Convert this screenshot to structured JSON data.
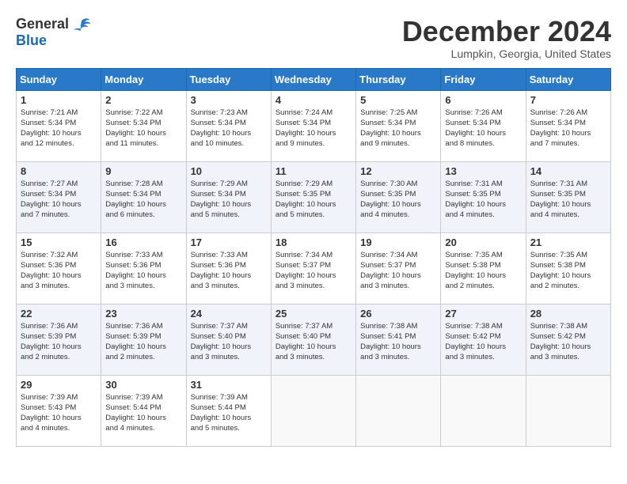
{
  "logo": {
    "general": "General",
    "blue": "Blue"
  },
  "title": "December 2024",
  "location": "Lumpkin, Georgia, United States",
  "days_of_week": [
    "Sunday",
    "Monday",
    "Tuesday",
    "Wednesday",
    "Thursday",
    "Friday",
    "Saturday"
  ],
  "weeks": [
    [
      {
        "day": "1",
        "sunrise": "7:21 AM",
        "sunset": "5:34 PM",
        "daylight": "10 hours and 12 minutes."
      },
      {
        "day": "2",
        "sunrise": "7:22 AM",
        "sunset": "5:34 PM",
        "daylight": "10 hours and 11 minutes."
      },
      {
        "day": "3",
        "sunrise": "7:23 AM",
        "sunset": "5:34 PM",
        "daylight": "10 hours and 10 minutes."
      },
      {
        "day": "4",
        "sunrise": "7:24 AM",
        "sunset": "5:34 PM",
        "daylight": "10 hours and 9 minutes."
      },
      {
        "day": "5",
        "sunrise": "7:25 AM",
        "sunset": "5:34 PM",
        "daylight": "10 hours and 9 minutes."
      },
      {
        "day": "6",
        "sunrise": "7:26 AM",
        "sunset": "5:34 PM",
        "daylight": "10 hours and 8 minutes."
      },
      {
        "day": "7",
        "sunrise": "7:26 AM",
        "sunset": "5:34 PM",
        "daylight": "10 hours and 7 minutes."
      }
    ],
    [
      {
        "day": "8",
        "sunrise": "7:27 AM",
        "sunset": "5:34 PM",
        "daylight": "10 hours and 7 minutes."
      },
      {
        "day": "9",
        "sunrise": "7:28 AM",
        "sunset": "5:34 PM",
        "daylight": "10 hours and 6 minutes."
      },
      {
        "day": "10",
        "sunrise": "7:29 AM",
        "sunset": "5:34 PM",
        "daylight": "10 hours and 5 minutes."
      },
      {
        "day": "11",
        "sunrise": "7:29 AM",
        "sunset": "5:35 PM",
        "daylight": "10 hours and 5 minutes."
      },
      {
        "day": "12",
        "sunrise": "7:30 AM",
        "sunset": "5:35 PM",
        "daylight": "10 hours and 4 minutes."
      },
      {
        "day": "13",
        "sunrise": "7:31 AM",
        "sunset": "5:35 PM",
        "daylight": "10 hours and 4 minutes."
      },
      {
        "day": "14",
        "sunrise": "7:31 AM",
        "sunset": "5:35 PM",
        "daylight": "10 hours and 4 minutes."
      }
    ],
    [
      {
        "day": "15",
        "sunrise": "7:32 AM",
        "sunset": "5:36 PM",
        "daylight": "10 hours and 3 minutes."
      },
      {
        "day": "16",
        "sunrise": "7:33 AM",
        "sunset": "5:36 PM",
        "daylight": "10 hours and 3 minutes."
      },
      {
        "day": "17",
        "sunrise": "7:33 AM",
        "sunset": "5:36 PM",
        "daylight": "10 hours and 3 minutes."
      },
      {
        "day": "18",
        "sunrise": "7:34 AM",
        "sunset": "5:37 PM",
        "daylight": "10 hours and 3 minutes."
      },
      {
        "day": "19",
        "sunrise": "7:34 AM",
        "sunset": "5:37 PM",
        "daylight": "10 hours and 3 minutes."
      },
      {
        "day": "20",
        "sunrise": "7:35 AM",
        "sunset": "5:38 PM",
        "daylight": "10 hours and 2 minutes."
      },
      {
        "day": "21",
        "sunrise": "7:35 AM",
        "sunset": "5:38 PM",
        "daylight": "10 hours and 2 minutes."
      }
    ],
    [
      {
        "day": "22",
        "sunrise": "7:36 AM",
        "sunset": "5:39 PM",
        "daylight": "10 hours and 2 minutes."
      },
      {
        "day": "23",
        "sunrise": "7:36 AM",
        "sunset": "5:39 PM",
        "daylight": "10 hours and 2 minutes."
      },
      {
        "day": "24",
        "sunrise": "7:37 AM",
        "sunset": "5:40 PM",
        "daylight": "10 hours and 3 minutes."
      },
      {
        "day": "25",
        "sunrise": "7:37 AM",
        "sunset": "5:40 PM",
        "daylight": "10 hours and 3 minutes."
      },
      {
        "day": "26",
        "sunrise": "7:38 AM",
        "sunset": "5:41 PM",
        "daylight": "10 hours and 3 minutes."
      },
      {
        "day": "27",
        "sunrise": "7:38 AM",
        "sunset": "5:42 PM",
        "daylight": "10 hours and 3 minutes."
      },
      {
        "day": "28",
        "sunrise": "7:38 AM",
        "sunset": "5:42 PM",
        "daylight": "10 hours and 3 minutes."
      }
    ],
    [
      {
        "day": "29",
        "sunrise": "7:39 AM",
        "sunset": "5:43 PM",
        "daylight": "10 hours and 4 minutes."
      },
      {
        "day": "30",
        "sunrise": "7:39 AM",
        "sunset": "5:44 PM",
        "daylight": "10 hours and 4 minutes."
      },
      {
        "day": "31",
        "sunrise": "7:39 AM",
        "sunset": "5:44 PM",
        "daylight": "10 hours and 5 minutes."
      },
      null,
      null,
      null,
      null
    ]
  ],
  "labels": {
    "sunrise": "Sunrise:",
    "sunset": "Sunset:",
    "daylight": "Daylight:"
  }
}
